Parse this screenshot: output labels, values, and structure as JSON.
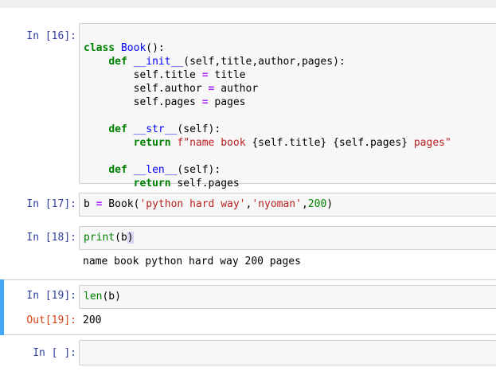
{
  "cells": [
    {
      "prompt": "In [16]:",
      "code_lines": [
        "class Book():",
        "    def __init__(self,title,author,pages):",
        "        self.title = title",
        "        self.author = author",
        "        self.pages = pages",
        "",
        "    def __str__(self):",
        "        return f\"name book {self.title} {self.pages} pages\"",
        "",
        "    def __len__(self):",
        "        return self.pages"
      ]
    },
    {
      "prompt": "In [17]:",
      "code_lines": [
        "b = Book('python hard way','nyoman',200)"
      ]
    },
    {
      "prompt": "In [18]:",
      "code_lines": [
        "print(b)"
      ],
      "output": "name book python hard way 200 pages"
    },
    {
      "prompt": "In [19]:",
      "code_lines": [
        "len(b)"
      ],
      "out_prompt": "Out[19]:",
      "output": "200"
    },
    {
      "prompt": "In [ ]:",
      "code_lines": [
        ""
      ]
    }
  ],
  "colors": {
    "in_prompt": "#303f9f",
    "out_prompt": "#d84315",
    "selected_cell_bar": "#42a5f5",
    "keyword": "#008000",
    "function_name": "#0000ff",
    "string": "#ba2121",
    "operator": "#aa22ff"
  }
}
